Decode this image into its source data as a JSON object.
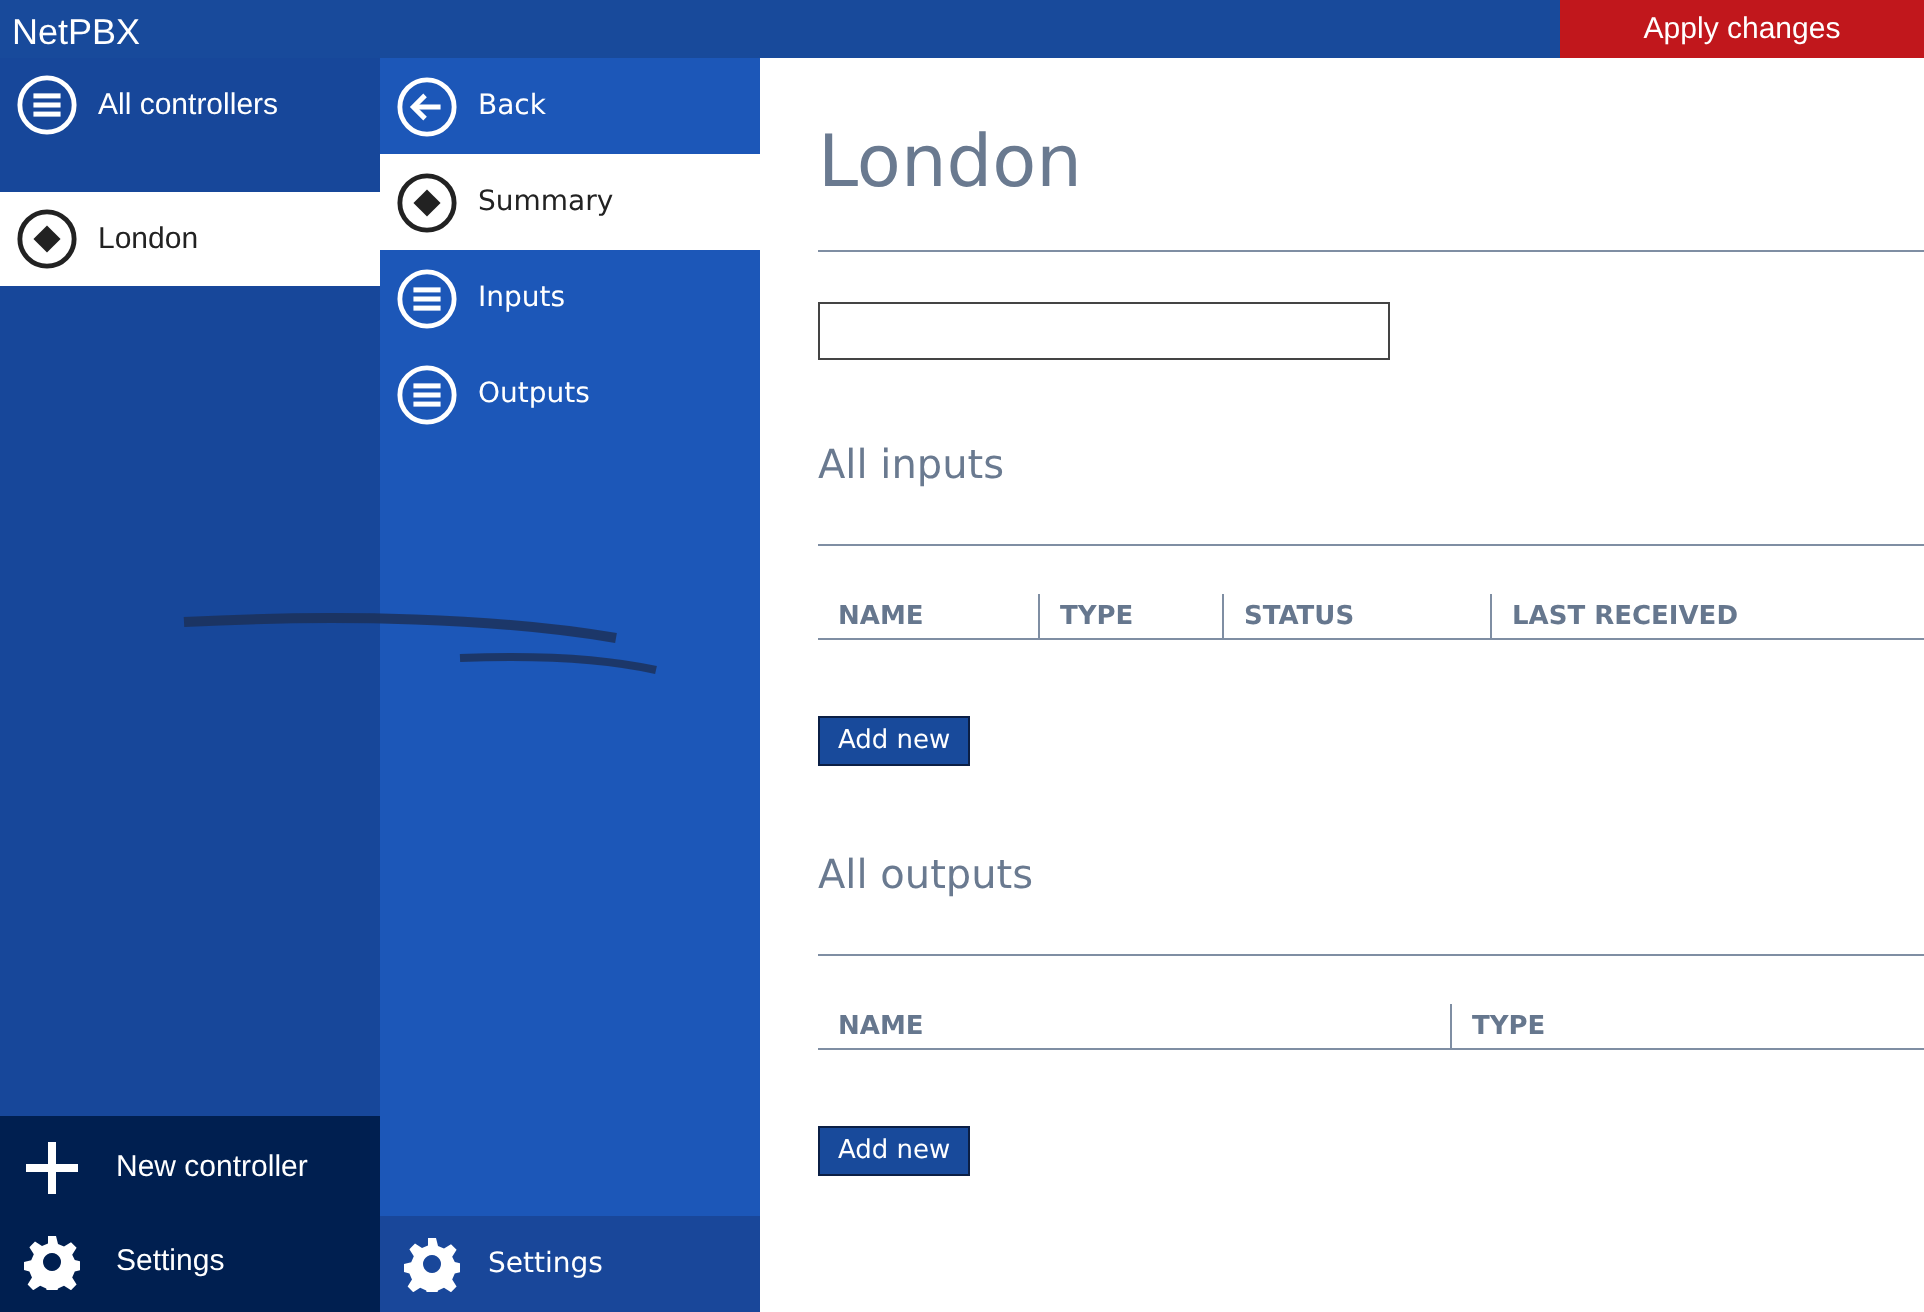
{
  "app_title": "NetPBX",
  "apply_button": "Apply changes",
  "controllers_nav": {
    "header": {
      "label": "All controllers",
      "kind": "list"
    },
    "items": [
      {
        "label": "London",
        "kind": "diamond",
        "selected": true
      }
    ],
    "footer": [
      {
        "label": "New controller",
        "kind": "plus"
      },
      {
        "label": "Settings",
        "kind": "gear"
      }
    ]
  },
  "section_nav": {
    "items": [
      {
        "label": "Back",
        "kind": "back",
        "selected": false
      },
      {
        "label": "Summary",
        "kind": "diamond",
        "selected": true
      },
      {
        "label": "Inputs",
        "kind": "list",
        "selected": false
      },
      {
        "label": "Outputs",
        "kind": "list",
        "selected": false
      }
    ],
    "footer": {
      "label": "Settings",
      "kind": "gear"
    }
  },
  "content": {
    "title": "London",
    "sections": [
      {
        "heading": "All inputs",
        "columns": [
          "NAME",
          "TYPE",
          "STATUS",
          "LAST RECEIVED"
        ],
        "button": "Add new"
      },
      {
        "heading": "All outputs",
        "columns": [
          "NAME",
          "TYPE"
        ],
        "button": "Add new"
      }
    ]
  }
}
